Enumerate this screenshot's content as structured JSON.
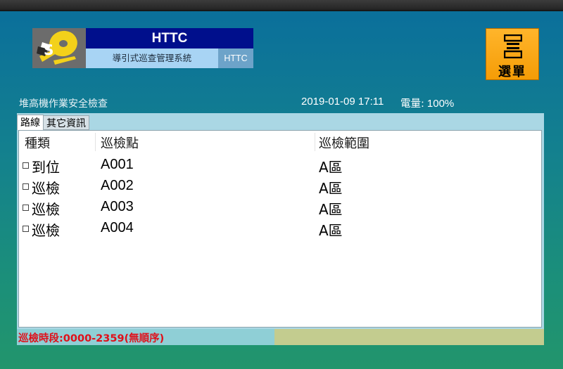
{
  "header": {
    "app_title": "HTTC",
    "app_subtitle": "導引式巡查管理系統",
    "app_tag": "HTTC",
    "logo_icon": "sd-disc-logo-icon"
  },
  "menu_button": {
    "label": "選單",
    "icon": "menu-list-icon"
  },
  "info": {
    "section_title": "堆高機作業安全檢查",
    "datetime": "2019-01-09 17:11",
    "battery_label": "電量:",
    "battery_value": "100%"
  },
  "tabs": [
    {
      "label": "路線",
      "active": true
    },
    {
      "label": "其它資訊",
      "active": false
    }
  ],
  "table": {
    "headers": [
      "種類",
      "巡檢點",
      "巡檢範圍"
    ],
    "rows": [
      {
        "type": "到位",
        "point": "A001",
        "range": "A區"
      },
      {
        "type": "巡檢",
        "point": "A002",
        "range": "A區"
      },
      {
        "type": "巡檢",
        "point": "A003",
        "range": "A區"
      },
      {
        "type": "巡檢",
        "point": "A004",
        "range": "A區"
      }
    ]
  },
  "status": {
    "time_window": "巡檢時段:0000-2359(無順序)"
  },
  "colors": {
    "title_bg": "#000f8c",
    "subtitle_bg": "#a8d4f4",
    "menu_bg": "#f59c06",
    "status_text": "#e0101a"
  }
}
